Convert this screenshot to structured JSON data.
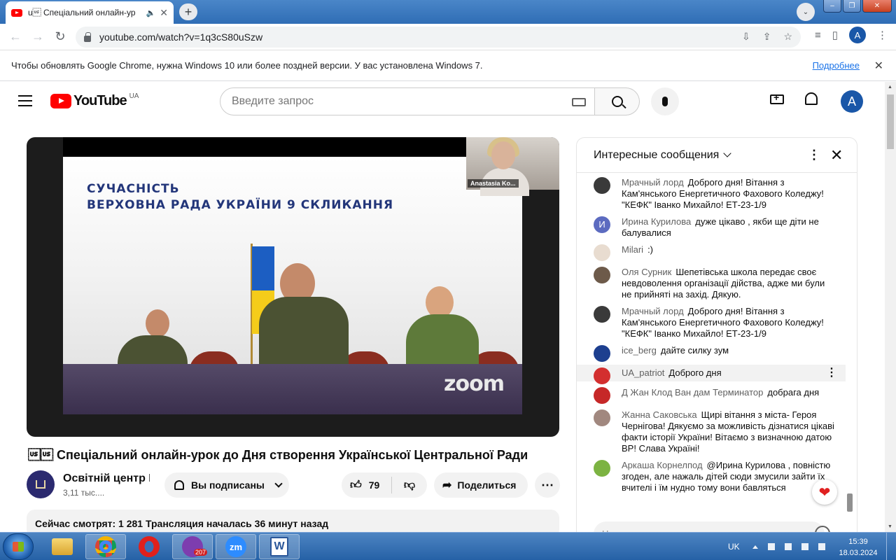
{
  "browser": {
    "tab_title": "u\u001f Спеціальний онлайн-ур",
    "tab_sound": "🔈",
    "url": "youtube.com/watch?v=1q3cS80uSzw",
    "infobar_text": "Чтобы обновлять Google Chrome, нужна Windows 10 или более поздней версии. У вас установлена Windows 7.",
    "infobar_link": "Подробнее",
    "profile_letter": "A"
  },
  "youtube": {
    "logo_text": "YouTube",
    "region": "UA",
    "search_placeholder": "Введите запрос",
    "avatar_letter": "A"
  },
  "video": {
    "slide_line1": "СУЧАСНІСТЬ",
    "slide_line2": "ВЕРХОВНА РАДА УКРАЇНИ 9 СКЛИКАННЯ",
    "zoom_watermark": "zoom",
    "cam_name": "Anastasia Ko...",
    "title": "\u001f\u001f Спеціальний онлайн-урок до Дня створення Української Центральної Ради",
    "channel_name": "Освітній центр В",
    "channel_subs": "3,11 тыс....",
    "subscribed_label": "Вы подписаны",
    "like_count": "79",
    "share_label": "Поделиться",
    "desc_text": "Сейчас смотрят: 1 281  Трансляция началась 36 минут назад"
  },
  "chat": {
    "header": "Интересные сообщения",
    "input_placeholder": "Напишите в чат для подписчиков...",
    "messages": [
      {
        "author": "Мрачный лорд",
        "text": "Доброго дня! Вітання з Кам'янського Енергетичного Фахового Коледжу! \"КЕФК\" Іванко Михайло! ЕТ-23-1/9",
        "color": "#3a3a3a"
      },
      {
        "author": "Ирина Курилова",
        "text": "дуже цікаво , якби ще діти не балувалися",
        "color": "#5c6bc0",
        "initial": "И"
      },
      {
        "author": "Milari",
        "text": ":)",
        "color": "#e8dcd0"
      },
      {
        "author": "Оля Сурник",
        "text": "Шепетівська школа передає своє невдоволення організації дійства, адже ми були не прийняті на захід. Дякую.",
        "color": "#6d5a4a"
      },
      {
        "author": "Мрачный лорд",
        "text": "Доброго дня! Вітання з Кам'янського Енергетичного Фахового Коледжу! \"КЕФК\" Іванко Михайло! ЕТ-23-1/9",
        "color": "#3a3a3a"
      },
      {
        "author": "ice_berg",
        "text": "дайте силку зум",
        "color": "#1d3f8f"
      },
      {
        "author": "UA_patriot",
        "text": "Доброго дня",
        "color": "#d32f2f"
      },
      {
        "author": "Д Жан Клод Ван дам Терминатор",
        "text": "добрага дня",
        "color": "#c62828"
      },
      {
        "author": "Жанна Саковська",
        "text": "Щирі вітання з міста- Героя Чернігова! Дякуємо за можливість дізнатися цікаві факти історії України! Вітаємо з визначною датою ВР! Слава Україні!",
        "color": "#a1887f"
      },
      {
        "author": "Аркаша Корнелпод",
        "text": "@Ирина Курилова , повністю згоден, але нажаль дітей сюди змусили зайти їх вчителі і їм нудно тому вони бавляться",
        "color": "#7cb342"
      }
    ]
  },
  "taskbar": {
    "viber_badge": "207",
    "zoom_label": "zm",
    "word_label": "W",
    "lang": "UK",
    "time": "15:39",
    "date": "18.03.2024"
  }
}
